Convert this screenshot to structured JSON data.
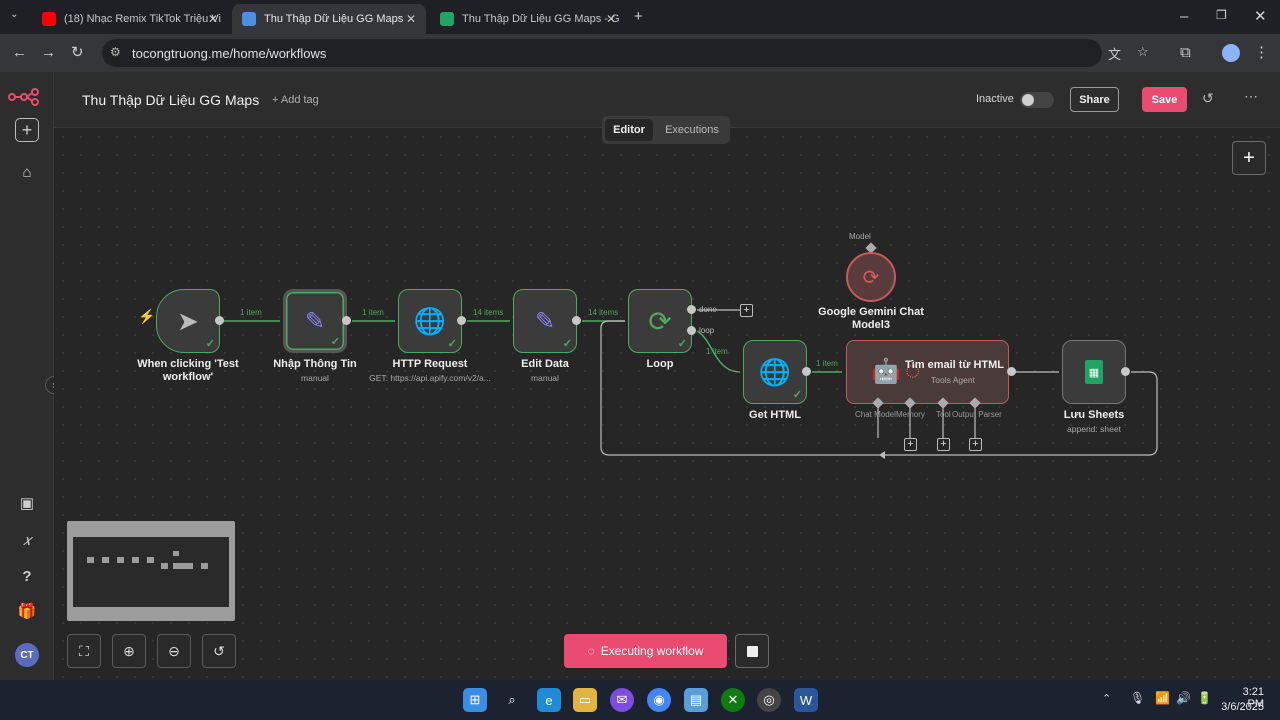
{
  "browser": {
    "tabs": [
      {
        "label": "(18) Nhạc Remix TikTok Triệu Vi",
        "color": "#ff0000"
      },
      {
        "label": "Thu Thập Dữ Liệu GG Maps",
        "color": "#ea4b71"
      },
      {
        "label": "Thu Thập Dữ Liệu GG Maps - G",
        "color": "#1fa463"
      }
    ],
    "url": "tocongtruong.me/home/workflows"
  },
  "header": {
    "title": "Thu Thập Dữ Liệu GG Maps",
    "add_tag": "+ Add tag",
    "status": "Inactive",
    "share": "Share",
    "save": "Save"
  },
  "view_tabs": {
    "editor": "Editor",
    "executions": "Executions"
  },
  "nodes": {
    "trigger": {
      "label": "When clicking 'Test workflow'",
      "icon": "cursor-icon"
    },
    "nhap": {
      "label": "Nhập Thông Tin",
      "sub": "manual",
      "icon": "pencil-icon"
    },
    "http": {
      "label": "HTTP Request",
      "sub": "GET: https://api.apify.com/v2/a...",
      "icon": "globe-icon"
    },
    "edit": {
      "label": "Edit Data",
      "sub": "manual",
      "icon": "pencil-icon"
    },
    "loop": {
      "label": "Loop",
      "icon": "refresh-icon"
    },
    "gethtml": {
      "label": "Get HTML",
      "icon": "globe-icon"
    },
    "agent": {
      "label": "Tìm email từ HTML",
      "sub": "Tools Agent"
    },
    "gemini": {
      "label": "Google Gemini Chat Model3",
      "port": "Model"
    },
    "sheets": {
      "label": "Lưu Sheets",
      "sub": "append: sheet"
    }
  },
  "edges": {
    "e1": "1 item",
    "e2": "1 item",
    "e3": "14 items",
    "e4": "14 items",
    "done": "done",
    "loop": "loop",
    "e5": "1 item",
    "e6": "1 item"
  },
  "agent_ports": {
    "chat": "Chat Model",
    "memory": "Memory",
    "tool": "Tool",
    "parser": "Output Parser"
  },
  "executing": "Executing workflow",
  "taskbar": {
    "time": "3:21 PM",
    "date": "3/6/2025"
  },
  "colors": {
    "accent": "#ea4b71",
    "success": "#4fa861",
    "node_bg": "#3b3b3b"
  }
}
